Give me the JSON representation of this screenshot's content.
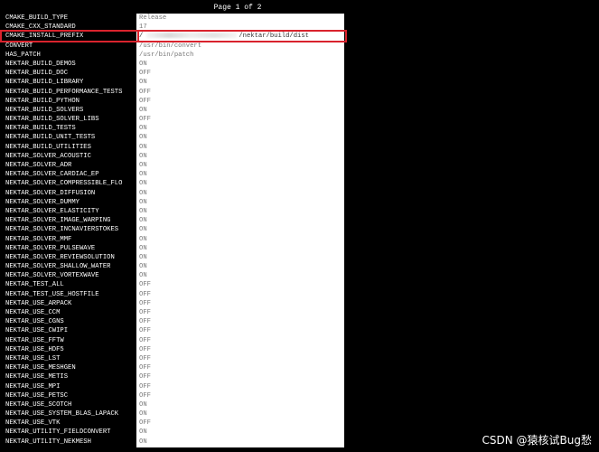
{
  "header": {
    "page_indicator": "Page 1 of 2"
  },
  "entries": [
    {
      "name": "CMAKE_BUILD_TYPE",
      "value": "Release"
    },
    {
      "name": "CMAKE_CXX_STANDARD",
      "value": "17"
    },
    {
      "name": "CMAKE_INSTALL_PREFIX",
      "value": "/nektar/build/dist"
    },
    {
      "name": "CONVERT",
      "value": "/usr/bin/convert"
    },
    {
      "name": "HAS_PATCH",
      "value": "/usr/bin/patch"
    },
    {
      "name": "NEKTAR_BUILD_DEMOS",
      "value": "ON"
    },
    {
      "name": "NEKTAR_BUILD_DOC",
      "value": "OFF"
    },
    {
      "name": "NEKTAR_BUILD_LIBRARY",
      "value": "ON"
    },
    {
      "name": "NEKTAR_BUILD_PERFORMANCE_TESTS",
      "value": "OFF"
    },
    {
      "name": "NEKTAR_BUILD_PYTHON",
      "value": "OFF"
    },
    {
      "name": "NEKTAR_BUILD_SOLVERS",
      "value": "ON"
    },
    {
      "name": "NEKTAR_BUILD_SOLVER_LIBS",
      "value": "OFF"
    },
    {
      "name": "NEKTAR_BUILD_TESTS",
      "value": "ON"
    },
    {
      "name": "NEKTAR_BUILD_UNIT_TESTS",
      "value": "ON"
    },
    {
      "name": "NEKTAR_BUILD_UTILITIES",
      "value": "ON"
    },
    {
      "name": "NEKTAR_SOLVER_ACOUSTIC",
      "value": "ON"
    },
    {
      "name": "NEKTAR_SOLVER_ADR",
      "value": "ON"
    },
    {
      "name": "NEKTAR_SOLVER_CARDIAC_EP",
      "value": "ON"
    },
    {
      "name": "NEKTAR_SOLVER_COMPRESSIBLE_FLO",
      "value": "ON"
    },
    {
      "name": "NEKTAR_SOLVER_DIFFUSION",
      "value": "ON"
    },
    {
      "name": "NEKTAR_SOLVER_DUMMY",
      "value": "ON"
    },
    {
      "name": "NEKTAR_SOLVER_ELASTICITY",
      "value": "ON"
    },
    {
      "name": "NEKTAR_SOLVER_IMAGE_WARPING",
      "value": "ON"
    },
    {
      "name": "NEKTAR_SOLVER_INCNAVIERSTOKES",
      "value": "ON"
    },
    {
      "name": "NEKTAR_SOLVER_MMF",
      "value": "ON"
    },
    {
      "name": "NEKTAR_SOLVER_PULSEWAVE",
      "value": "ON"
    },
    {
      "name": "NEKTAR_SOLVER_REVIEWSOLUTION",
      "value": "ON"
    },
    {
      "name": "NEKTAR_SOLVER_SHALLOW_WATER",
      "value": "ON"
    },
    {
      "name": "NEKTAR_SOLVER_VORTEXWAVE",
      "value": "ON"
    },
    {
      "name": "NEKTAR_TEST_ALL",
      "value": "OFF"
    },
    {
      "name": "NEKTAR_TEST_USE_HOSTFILE",
      "value": "OFF"
    },
    {
      "name": "NEKTAR_USE_ARPACK",
      "value": "OFF"
    },
    {
      "name": "NEKTAR_USE_CCM",
      "value": "OFF"
    },
    {
      "name": "NEKTAR_USE_CGNS",
      "value": "OFF"
    },
    {
      "name": "NEKTAR_USE_CWIPI",
      "value": "OFF"
    },
    {
      "name": "NEKTAR_USE_FFTW",
      "value": "OFF"
    },
    {
      "name": "NEKTAR_USE_HDF5",
      "value": "OFF"
    },
    {
      "name": "NEKTAR_USE_LST",
      "value": "OFF"
    },
    {
      "name": "NEKTAR_USE_MESHGEN",
      "value": "OFF"
    },
    {
      "name": "NEKTAR_USE_METIS",
      "value": "OFF"
    },
    {
      "name": "NEKTAR_USE_MPI",
      "value": "OFF"
    },
    {
      "name": "NEKTAR_USE_PETSC",
      "value": "OFF"
    },
    {
      "name": "NEKTAR_USE_SCOTCH",
      "value": "ON"
    },
    {
      "name": "NEKTAR_USE_SYSTEM_BLAS_LAPACK",
      "value": "ON"
    },
    {
      "name": "NEKTAR_USE_VTK",
      "value": "OFF"
    },
    {
      "name": "NEKTAR_UTILITY_FIELDCONVERT",
      "value": "ON"
    },
    {
      "name": "NEKTAR_UTILITY_NEKMESH",
      "value": "ON"
    }
  ],
  "watermark": "CSDN @猿核试Bug愁",
  "colors": {
    "highlight": "#d9232d",
    "background": "#000000",
    "value_panel": "#ffffff"
  }
}
